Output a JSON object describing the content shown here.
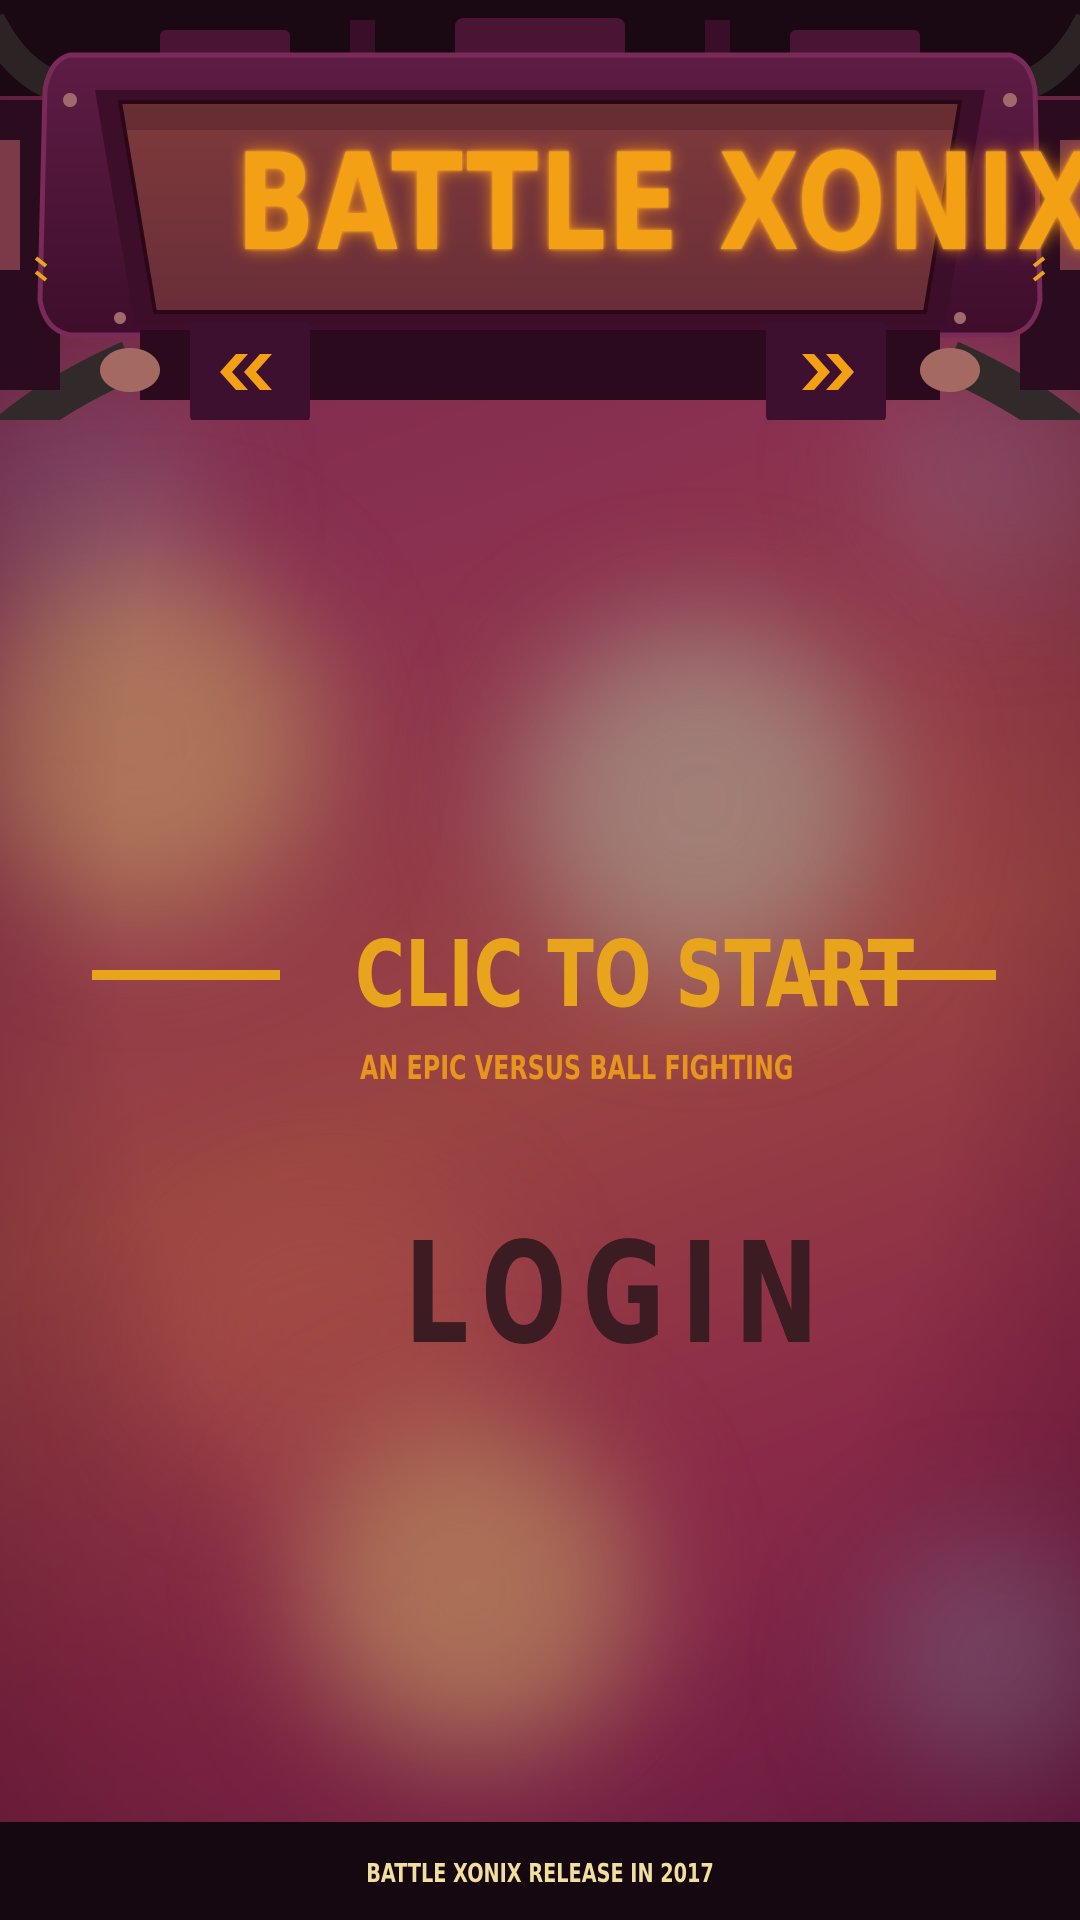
{
  "header": {
    "title": "BATTLE XONIX",
    "prev_icon": "double-chevron-left-icon",
    "next_icon": "double-chevron-right-icon"
  },
  "main": {
    "start_label": "CLIC TO START",
    "tagline": "AN EPIC VERSUS BALL FIGHTING",
    "login_label": "LOGIN"
  },
  "footer": {
    "text": "BATTLE XONIX RELEASE IN 2017"
  },
  "colors": {
    "accent": "#e8a41c",
    "title_glow": "#f4a015",
    "login_text": "#3a1c22",
    "frame": "#5a1a3c",
    "footer_bg": "#160810"
  }
}
